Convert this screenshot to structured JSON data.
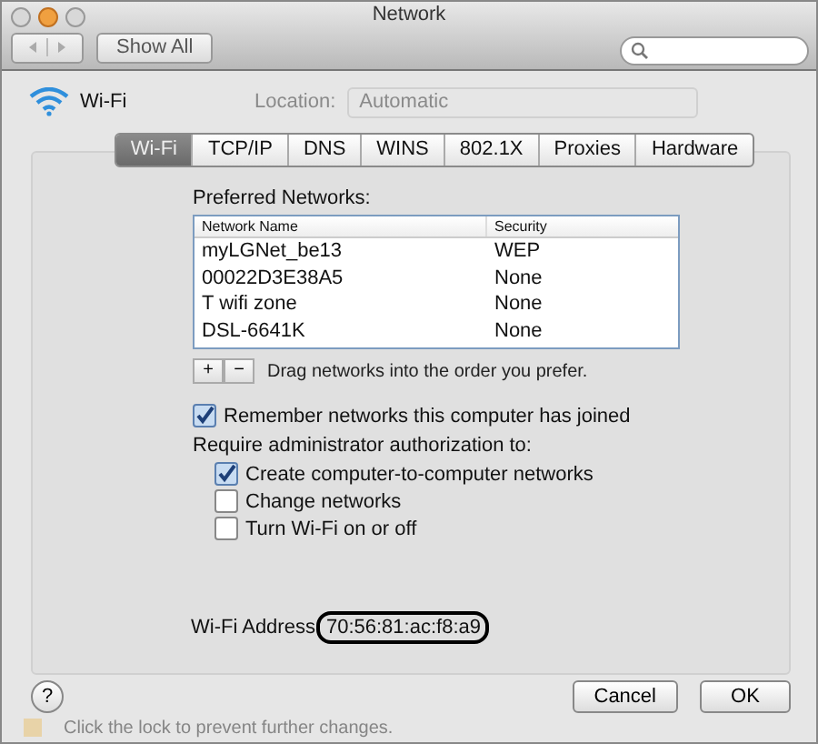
{
  "window": {
    "title": "Network"
  },
  "toolbar": {
    "show_all": "Show All"
  },
  "service": {
    "name": "Wi-Fi"
  },
  "location": {
    "label": "Location:",
    "value": "Automatic"
  },
  "tabs": [
    {
      "label": "Wi-Fi",
      "selected": true
    },
    {
      "label": "TCP/IP",
      "selected": false
    },
    {
      "label": "DNS",
      "selected": false
    },
    {
      "label": "WINS",
      "selected": false
    },
    {
      "label": "802.1X",
      "selected": false
    },
    {
      "label": "Proxies",
      "selected": false
    },
    {
      "label": "Hardware",
      "selected": false
    }
  ],
  "preferred_networks": {
    "label": "Preferred Networks:",
    "columns": [
      "Network Name",
      "Security"
    ],
    "rows": [
      {
        "name": "myLGNet_be13",
        "security": "WEP"
      },
      {
        "name": "00022D3E38A5",
        "security": "None"
      },
      {
        "name": "T wifi zone",
        "security": "None"
      },
      {
        "name": "DSL-6641K",
        "security": "None"
      }
    ],
    "add": "+",
    "remove": "−",
    "hint": "Drag networks into the order you prefer."
  },
  "remember": {
    "label": "Remember networks this computer has joined",
    "checked": true
  },
  "admin": {
    "label": "Require administrator authorization to:",
    "options": [
      {
        "label": "Create computer-to-computer networks",
        "checked": true
      },
      {
        "label": "Change networks",
        "checked": false
      },
      {
        "label": "Turn Wi-Fi on or off",
        "checked": false
      }
    ]
  },
  "address": {
    "label": "Wi-Fi Address",
    "value": "70:56:81:ac:f8:a9",
    "highlighted": true
  },
  "help": "?",
  "buttons": [
    {
      "label": "Cancel"
    },
    {
      "label": "OK"
    }
  ],
  "footer": "Click the lock to prevent further changes."
}
